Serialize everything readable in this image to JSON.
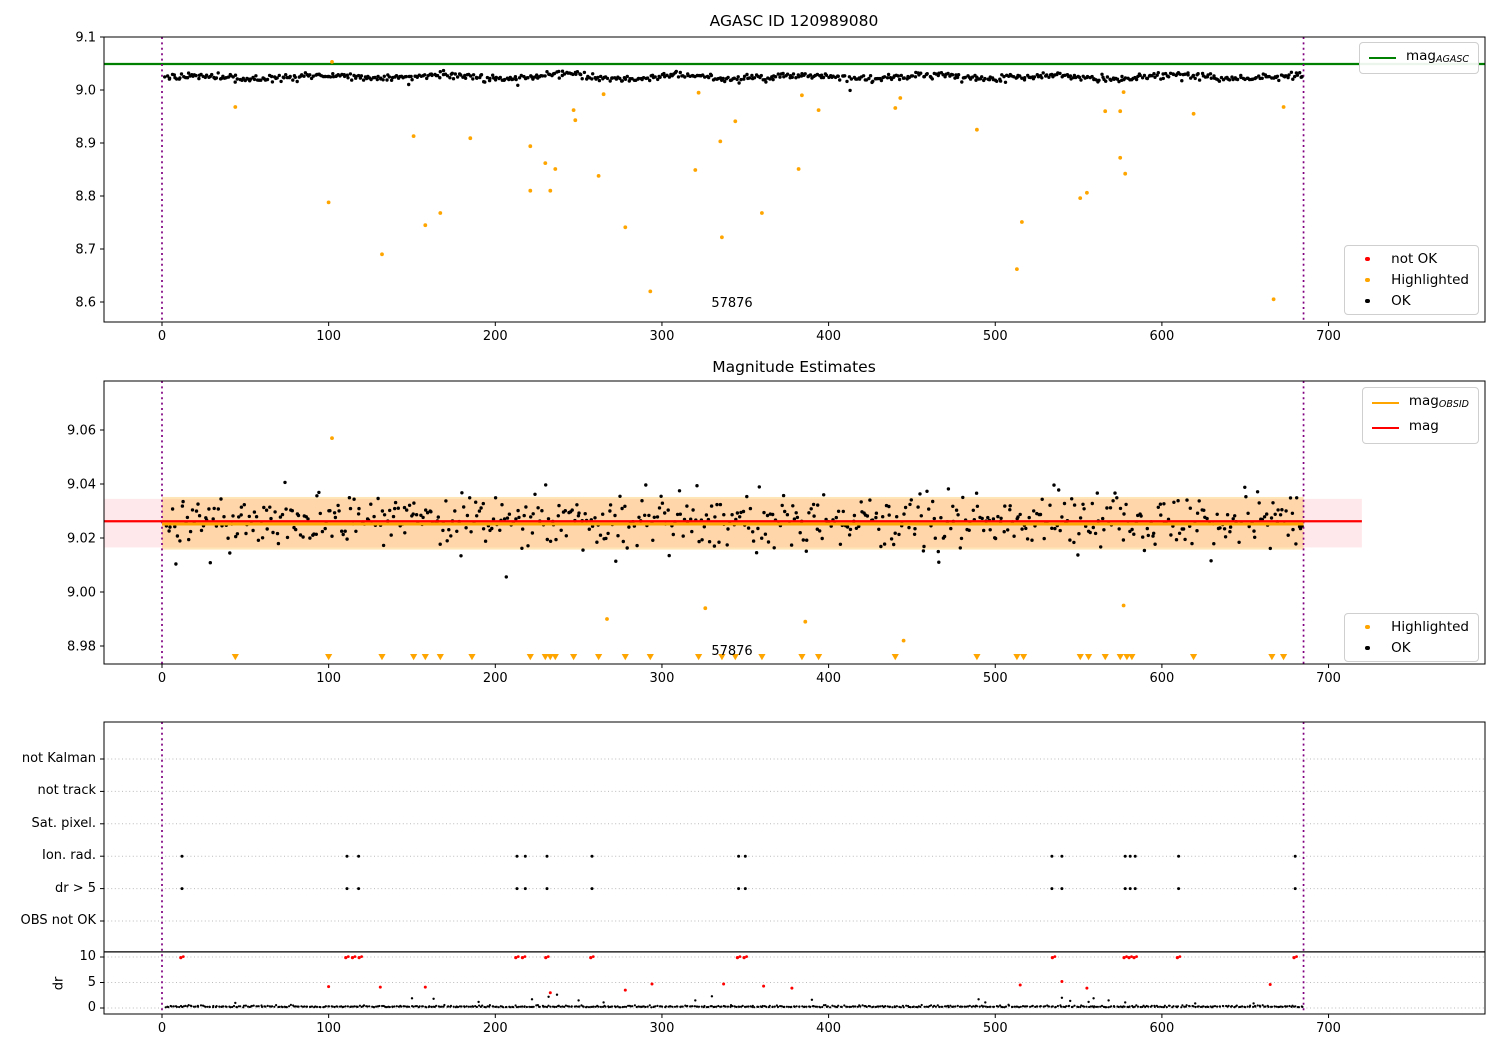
{
  "colors": {
    "green": "#008000",
    "orange": "#ffa500",
    "red": "#ff0000",
    "black": "#000000",
    "purple": "#800080",
    "grid": "#bbbbbb",
    "band_pink": "rgba(255,30,70,0.10)",
    "band_orange": "rgba(255,165,0,0.28)"
  },
  "chart_data": [
    {
      "name": "mag-overview",
      "type": "scatter",
      "title": "AGASC ID 120989080",
      "annotation": {
        "text": "57876",
        "x": 342,
        "y": 8.598
      },
      "xticks": [
        "0",
        "100",
        "200",
        "300",
        "400",
        "500",
        "600",
        "700"
      ],
      "xtick_vals": [
        0,
        100,
        200,
        300,
        400,
        500,
        600,
        700
      ],
      "yticks": [
        "9.1",
        "9.0",
        "8.9",
        "8.8",
        "8.7",
        "8.6"
      ],
      "ytick_vals": [
        9.1,
        9.0,
        8.9,
        8.8,
        8.7,
        8.6
      ],
      "xlim": [
        -34.8,
        793.3
      ],
      "ylim": [
        8.562,
        9.1
      ],
      "mag_agasc": 9.049,
      "obsid_span": [
        0,
        685
      ],
      "legend_lines": {
        "items": [
          {
            "label_main": "mag",
            "label_sub": "AGASC",
            "color": "green"
          }
        ]
      },
      "legend_points": {
        "items": [
          {
            "label": "not OK",
            "color": "red"
          },
          {
            "label": "Highlighted",
            "color": "orange"
          },
          {
            "label": "OK",
            "color": "black"
          }
        ]
      },
      "highlighted": [
        [
          44,
          8.968
        ],
        [
          100,
          8.788
        ],
        [
          102,
          9.053
        ],
        [
          132,
          8.69
        ],
        [
          151,
          8.913
        ],
        [
          158,
          8.745
        ],
        [
          167,
          8.768
        ],
        [
          185,
          8.909
        ],
        [
          221,
          8.894
        ],
        [
          221,
          8.81
        ],
        [
          230,
          8.862
        ],
        [
          233,
          8.81
        ],
        [
          236,
          8.851
        ],
        [
          247,
          8.962
        ],
        [
          248,
          8.943
        ],
        [
          262,
          8.838
        ],
        [
          265,
          8.992
        ],
        [
          278,
          8.741
        ],
        [
          293,
          8.62
        ],
        [
          320,
          8.849
        ],
        [
          322,
          8.995
        ],
        [
          335,
          8.903
        ],
        [
          336,
          8.722
        ],
        [
          344,
          8.941
        ],
        [
          360,
          8.768
        ],
        [
          382,
          8.851
        ],
        [
          384,
          8.99
        ],
        [
          394,
          8.962
        ],
        [
          440,
          8.966
        ],
        [
          443,
          8.985
        ],
        [
          489,
          8.925
        ],
        [
          513,
          8.662
        ],
        [
          516,
          8.751
        ],
        [
          551,
          8.796
        ],
        [
          555,
          8.806
        ],
        [
          566,
          8.96
        ],
        [
          575,
          8.872
        ],
        [
          575,
          8.96
        ],
        [
          577,
          8.996
        ],
        [
          578,
          8.842
        ],
        [
          619,
          8.955
        ],
        [
          667,
          8.605
        ],
        [
          673,
          8.968
        ]
      ],
      "ok_gen": {
        "seed": 20989080,
        "count": 690,
        "x_range": [
          2,
          684.5
        ],
        "mean": 9.0247,
        "wave_amp": 0.0034,
        "wave_freq": 0.085,
        "noise_amp": 0.0095,
        "clip": [
          8.993,
          9.0452
        ],
        "dip_every": 67,
        "dip": 0.013
      }
    },
    {
      "name": "magnitude-estimates",
      "type": "scatter",
      "title": "Magnitude Estimates",
      "annotation": {
        "text": "57876",
        "x": 342,
        "y": 8.979
      },
      "xticks": [
        "0",
        "100",
        "200",
        "300",
        "400",
        "500",
        "600",
        "700"
      ],
      "xtick_vals": [
        0,
        100,
        200,
        300,
        400,
        500,
        600,
        700
      ],
      "yticks": [
        "9.06",
        "9.04",
        "9.02",
        "9.00",
        "8.98"
      ],
      "ytick_vals": [
        9.06,
        9.04,
        9.02,
        9.0,
        8.98
      ],
      "xlim": [
        -34.8,
        793.3
      ],
      "ylim": [
        8.9733,
        9.0781
      ],
      "mag": 9.0262,
      "mag_obsid": 9.0252,
      "mag_band": [
        9.0165,
        9.0345
      ],
      "obsid_band": [
        9.0157,
        9.0352
      ],
      "mag_span": [
        -34.8,
        720
      ],
      "obsid_span": [
        0,
        685
      ],
      "legend_lines": {
        "items": [
          {
            "label_main": "mag",
            "label_sub": "OBSID",
            "color": "orange"
          },
          {
            "label_main": "mag",
            "label_sub": "",
            "color": "red"
          }
        ]
      },
      "legend_points": {
        "items": [
          {
            "label": "Highlighted",
            "color": "orange"
          },
          {
            "label": "OK",
            "color": "black"
          }
        ]
      },
      "highlighted": [
        [
          102,
          9.057
        ],
        [
          267,
          8.99
        ],
        [
          326,
          8.994
        ],
        [
          386,
          8.989
        ],
        [
          445,
          8.982
        ],
        [
          577,
          8.995
        ]
      ],
      "flag_triangles_y": 8.976,
      "flag_triangles_x": [
        44,
        100,
        132,
        151,
        158,
        167,
        186,
        221,
        230,
        233,
        236,
        247,
        262,
        278,
        293,
        322,
        336,
        344,
        360,
        384,
        394,
        440,
        489,
        513,
        517,
        551,
        556,
        566,
        575,
        579,
        582,
        619,
        666,
        673
      ],
      "ok_gen": {
        "seed": 57876,
        "count": 620,
        "x_range": [
          3,
          684.5
        ],
        "mean": 9.0262,
        "noise_amp": 0.0135,
        "outlier_p": 0.1,
        "outlier_amp": 0.009,
        "clip": [
          9.001,
          9.0485
        ]
      }
    },
    {
      "name": "flags-and-dr",
      "type": "scatter",
      "rows": [
        "not Kalman",
        "not track",
        "Sat. pixel.",
        "Ion. rad.",
        "dr > 5",
        "OBS not OK"
      ],
      "dr_ticks": [
        "10",
        "5",
        "0"
      ],
      "dr_tick_vals": [
        10,
        5,
        0
      ],
      "ylabel": "dr",
      "xticks": [
        "0",
        "100",
        "200",
        "300",
        "400",
        "500",
        "600",
        "700"
      ],
      "xtick_vals": [
        0,
        100,
        200,
        300,
        400,
        500,
        600,
        700
      ],
      "xlim": [
        -34.8,
        793.3
      ],
      "obsid_span": [
        0,
        685
      ],
      "hline_dr": 11,
      "ion_rad_x": [
        12,
        111,
        118,
        213,
        218,
        231,
        258,
        346,
        350,
        534,
        540,
        578,
        581,
        584,
        610,
        680
      ],
      "dr_gt5_x": [
        12,
        111,
        118,
        213,
        218,
        231,
        258,
        346,
        350,
        534,
        540,
        578,
        581,
        584,
        610,
        680
      ],
      "dr_clipped": {
        "value": 10,
        "x": [
          12,
          111,
          115,
          119,
          213,
          217,
          231,
          258,
          346,
          350,
          535,
          578,
          581,
          584,
          610,
          680
        ]
      },
      "dr_red": [
        [
          100,
          4.2
        ],
        [
          131,
          4.1
        ],
        [
          158,
          4.1
        ],
        [
          233,
          3.0
        ],
        [
          278,
          3.5
        ],
        [
          294,
          4.7
        ],
        [
          337,
          4.7
        ],
        [
          361,
          4.3
        ],
        [
          378,
          3.9
        ],
        [
          515,
          4.5
        ],
        [
          540,
          5.2
        ],
        [
          555,
          3.9
        ],
        [
          665,
          4.6
        ]
      ],
      "dr_black_bumps": [
        [
          44,
          1.0
        ],
        [
          150,
          1.9
        ],
        [
          163,
          1.8
        ],
        [
          190,
          1.2
        ],
        [
          222,
          1.7
        ],
        [
          232,
          2.2
        ],
        [
          237,
          2.6
        ],
        [
          250,
          1.5
        ],
        [
          265,
          1.1
        ],
        [
          320,
          1.5
        ],
        [
          330,
          2.3
        ],
        [
          390,
          1.6
        ],
        [
          490,
          1.7
        ],
        [
          494,
          1.1
        ],
        [
          540,
          2.0
        ],
        [
          545,
          1.4
        ],
        [
          556,
          1.2
        ],
        [
          559,
          1.9
        ],
        [
          568,
          1.5
        ],
        [
          578,
          1.1
        ],
        [
          620,
          0.9
        ],
        [
          655,
          0.9
        ]
      ],
      "dr_gen": {
        "seed": 3,
        "count": 680,
        "x_range": [
          2,
          684.5
        ],
        "base": 0.13,
        "amp": 0.42,
        "jitter": 0.12
      }
    }
  ]
}
